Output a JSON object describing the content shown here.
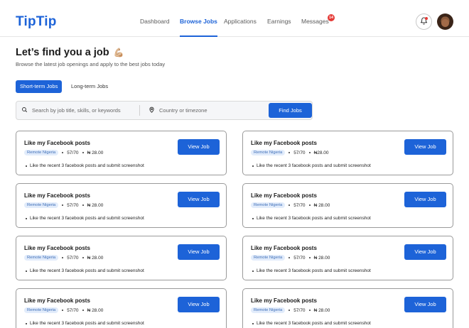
{
  "app": {
    "logo": "TipTip"
  },
  "nav": {
    "items": [
      "Dashboard",
      "Browse Jobs",
      "Applications",
      "Earnings",
      "Messages"
    ],
    "active": "Browse Jobs",
    "messages_badge": "14"
  },
  "header": {
    "title": "Let’s find you a job",
    "emoji": "💪🏼",
    "subtitle": "Browse the latest job openings and apply to the best jobs today"
  },
  "tabs": {
    "short_term": "Short-term Jobs",
    "long_term": "Long-term Jobs",
    "active": "Short-term Jobs"
  },
  "search": {
    "keyword_placeholder": "Search by job title, skills, or keywords",
    "location_placeholder": "Country or timezone",
    "button_label": "Find Jobs"
  },
  "jobs": [
    {
      "title": "Like my Facebook posts",
      "tag": "Remote Nigeria",
      "slots": "57/70",
      "price": "₦ 28.00",
      "task": "Like the recent 3 facebook posts and submit screenshot",
      "button": "View Job"
    },
    {
      "title": "Like my Facebook posts",
      "tag": "Remote Nigeria",
      "slots": "57/70",
      "price": "₦28.00",
      "task": "Like the recent 3 facebook posts and submit screenshot",
      "button": "View Job"
    },
    {
      "title": "Like my Facebook posts",
      "tag": "Remote Nigeria",
      "slots": "57/70",
      "price": "₦ 28.00",
      "task": "Like the recent 3 facebook posts and submit screenshot",
      "button": "View Job"
    },
    {
      "title": "Like my Facebook posts",
      "tag": "Remote Nigeria",
      "slots": "57/70",
      "price": "₦ 28.00",
      "task": "Like the recent 3 facebook posts and submit screenshot",
      "button": "View Job"
    },
    {
      "title": "Like my Facebook posts",
      "tag": "Remote Nigeria",
      "slots": "57/70",
      "price": "₦ 28.00",
      "task": "Like the recent 3 facebook posts and submit screenshot",
      "button": "View Job"
    },
    {
      "title": "Like my Facebook posts",
      "tag": "Remote Nigeria",
      "slots": "57/70",
      "price": "₦ 28.00",
      "task": "Like the recent 3 facebook posts and submit screenshot",
      "button": "View Job"
    },
    {
      "title": "Like my Facebook posts",
      "tag": "Remote Nigeria",
      "slots": "57/70",
      "price": "₦ 28.00",
      "task": "Like the recent 3 facebook posts and submit screenshot",
      "button": "View Job"
    },
    {
      "title": "Like my Facebook posts",
      "tag": "Remote Nigeria",
      "slots": "57/70",
      "price": "₦ 28.00",
      "task": "Like the recent 3 facebook posts and submit screenshot",
      "button": "View Job"
    }
  ],
  "colors": {
    "accent": "#1d63d8",
    "badge": "#e53935",
    "tag_bg": "#e2ecfb"
  },
  "icons": {
    "search": "search-icon",
    "location": "location-pin-icon",
    "notifications": "bell-icon"
  }
}
